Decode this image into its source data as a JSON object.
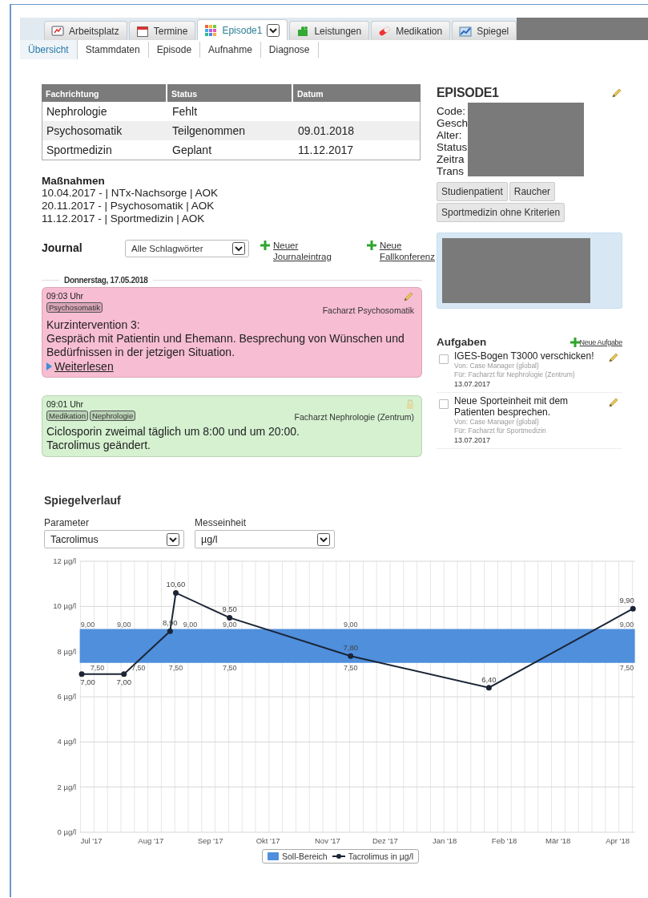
{
  "tabs": [
    {
      "label": "Arbeitsplatz",
      "selected": false,
      "dropdown": false
    },
    {
      "label": "Termine",
      "selected": false,
      "dropdown": false
    },
    {
      "label": "Episode1",
      "selected": true,
      "dropdown": true
    },
    {
      "label": "Leistungen",
      "selected": false,
      "dropdown": false
    },
    {
      "label": "Medikation",
      "selected": false,
      "dropdown": false
    },
    {
      "label": "Spiegel",
      "selected": false,
      "dropdown": false
    }
  ],
  "subtabs": [
    {
      "label": "Übersicht",
      "selected": true
    },
    {
      "label": "Stammdaten",
      "selected": false
    },
    {
      "label": "Episode",
      "selected": false
    },
    {
      "label": "Aufnahme",
      "selected": false
    },
    {
      "label": "Diagnose",
      "selected": false
    }
  ],
  "table": {
    "columns": [
      "Fachrichtung",
      "Status",
      "Datum"
    ],
    "rows": [
      {
        "cells": [
          "Nephrologie",
          "Fehlt"
        ]
      },
      {
        "cells": [
          "Psychosomatik",
          "Teilgenommen",
          "09.01.2018"
        ]
      },
      {
        "cells": [
          "Sportmedizin",
          "Geplant",
          "11.12.2017"
        ]
      }
    ]
  },
  "measures": {
    "title": "Maßnahmen",
    "lines": [
      "10.04.2017 - | NTx-Nachsorge | AOK",
      "20.11.2017 - | Psychosomatik | AOK",
      "11.12.2017 - | Sportmedizin | AOK"
    ]
  },
  "journal": {
    "title": "Journal",
    "filter": {
      "value": "Alle Schlagwörter"
    },
    "actions": [
      {
        "line1": "Neuer",
        "line2": "Journaleintrag"
      },
      {
        "line1": "Neue",
        "line2": "Fallkonferenz"
      }
    ],
    "date": "Donnerstag, 17.05.2018",
    "entries": [
      {
        "time": "09:03 Uhr",
        "tags": [
          "Psychosomatik"
        ],
        "author": "Facharzt Psychosomatik",
        "color": "#f7bdd2",
        "locked": false,
        "lines": [
          "Kurzintervention 3:",
          "Gespräch mit Patientin und Ehemann. Besprechung von Wünschen und Bedürfnissen in der jetzigen Situation."
        ],
        "more": "Weiterlesen"
      },
      {
        "time": "09:01 Uhr",
        "tags": [
          "Medikation",
          "Nephrologie"
        ],
        "author": "Facharzt Nephrologie (Zentrum)",
        "color": "#d5f1d0",
        "locked": true,
        "lines": [
          "Ciclosporin zweimal täglich um 8:00 und um 20:00.",
          "Tacrolimus geändert."
        ]
      }
    ]
  },
  "episode": {
    "title": "EPISODE1",
    "fields": [
      "Code:",
      "Gesch",
      "Alter:",
      "Status",
      "Zeitra",
      "Trans"
    ],
    "tags": [
      "Studienpatient",
      "Raucher",
      "Sportmedizin ohne Kriterien"
    ]
  },
  "tasks": {
    "title": "Aufgaben",
    "add": "Neue Aufgabe",
    "items": [
      {
        "title": "IGES-Bogen T3000 verschicken!",
        "from": "Von: Case Manager (global)",
        "to": "Für: Facharzt für Nephrologie (Zentrum)",
        "date": "13.07.2017",
        "checked": false
      },
      {
        "title": "Neue Sporteinheit mit dem Patienten besprechen.",
        "from": "Von: Case Manager (global)",
        "to": "Für: Facharzt für Sportmedizin",
        "date": "13.07.2017",
        "checked": false
      }
    ]
  },
  "levels": {
    "title": "Spiegelverlauf",
    "parameter": {
      "label": "Parameter",
      "value": "Tacrolimus"
    },
    "unit": {
      "label": "Messeinheit",
      "value": "µg/l"
    },
    "chart_data": {
      "type": "line",
      "x": [
        "2017-06-26",
        "2017-07-18",
        "2017-08-11",
        "2017-08-14",
        "2017-09-11",
        "2017-11-13",
        "2018-01-24",
        "2018-04-09"
      ],
      "xlim": [
        "2017-06-25",
        "2018-04-10"
      ],
      "xticks": [
        {
          "value": "2017-07-01",
          "label": "Jul '17"
        },
        {
          "value": "2017-08-01",
          "label": "Aug '17"
        },
        {
          "value": "2017-09-01",
          "label": "Sep '17"
        },
        {
          "value": "2017-10-01",
          "label": "Okt '17"
        },
        {
          "value": "2017-11-01",
          "label": "Nov '17"
        },
        {
          "value": "2017-12-01",
          "label": "Dez '17"
        },
        {
          "value": "2018-01-01",
          "label": "Jan '18"
        },
        {
          "value": "2018-02-01",
          "label": "Feb '18"
        },
        {
          "value": "2018-03-01",
          "label": "Mär '18"
        },
        {
          "value": "2018-04-01",
          "label": "Apr '18"
        }
      ],
      "ylim": [
        0,
        12
      ],
      "yticks": [
        {
          "value": 0,
          "label": "0 µg/l"
        },
        {
          "value": 2,
          "label": "2 µg/l"
        },
        {
          "value": 4,
          "label": "4 µg/l"
        },
        {
          "value": 6,
          "label": "6 µg/l"
        },
        {
          "value": 8,
          "label": "8 µg/l"
        },
        {
          "value": 10,
          "label": "10 µg/l"
        },
        {
          "value": 12,
          "label": "12 µg/l"
        }
      ],
      "grid": true,
      "legend": "bottom",
      "series": [
        {
          "name": "Tacrolimus in µg/l",
          "color": "#1b2535",
          "marker": true,
          "values": [
            7,
            7,
            8.9,
            10.6,
            9.5,
            7.8,
            6.4,
            9.9
          ],
          "value_labels": [
            "7,00",
            "7,00",
            "8,90",
            "10,60",
            "9,50",
            "7,80",
            "6,40",
            "9,90"
          ]
        }
      ],
      "bands": [
        {
          "axis": "y",
          "from": 7.5,
          "to": 9,
          "label": "Soll-Bereich",
          "color": "#4f8fdc"
        }
      ],
      "annotations": [
        {
          "x": "2017-06-26",
          "y": 9,
          "text": "9,00"
        },
        {
          "x": "2017-06-26",
          "y": 7.5,
          "text": "7,50"
        },
        {
          "x": "2017-07-18",
          "y": 9,
          "text": "9,00"
        },
        {
          "x": "2017-07-18",
          "y": 7.5,
          "text": "7,50"
        },
        {
          "x": "2017-08-14",
          "y": 9,
          "text": "9,00"
        },
        {
          "x": "2017-08-14",
          "y": 7.5,
          "text": "7,50"
        },
        {
          "x": "2017-09-11",
          "y": 9,
          "text": "9,00"
        },
        {
          "x": "2017-09-11",
          "y": 7.5,
          "text": "7,50"
        },
        {
          "x": "2017-11-13",
          "y": 9,
          "text": "9,00"
        },
        {
          "x": "2017-11-13",
          "y": 7.5,
          "text": "7,50"
        },
        {
          "x": "2018-04-09",
          "y": 9,
          "text": "9,00"
        },
        {
          "x": "2018-04-09",
          "y": 7.5,
          "text": "7,50"
        }
      ]
    }
  }
}
